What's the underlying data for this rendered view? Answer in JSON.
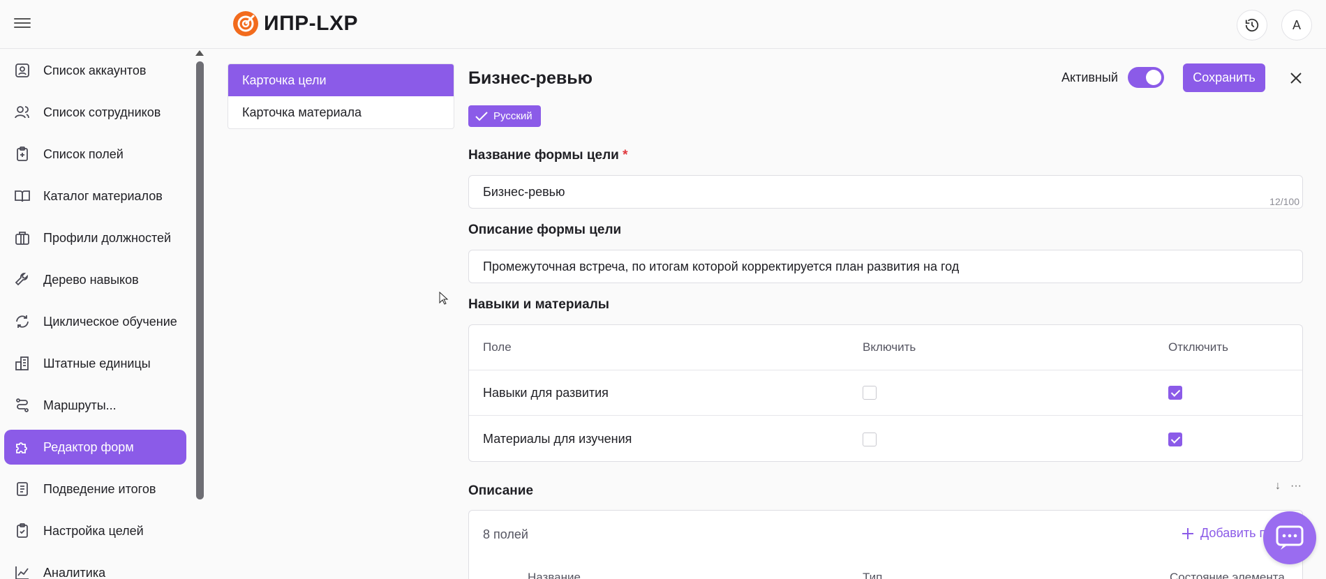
{
  "header": {
    "logo_text": "ИПР-LXP",
    "brand_color": "#f26b1d",
    "accent_color": "#8b5be8",
    "avatar_letter": "A"
  },
  "sidebar": {
    "items": [
      {
        "label": "Список аккаунтов",
        "icon": "account-card-icon"
      },
      {
        "label": "Список сотрудников",
        "icon": "users-icon"
      },
      {
        "label": "Список полей",
        "icon": "clipboard-plus-icon"
      },
      {
        "label": "Каталог материалов",
        "icon": "book-open-icon"
      },
      {
        "label": "Профили должностей",
        "icon": "briefcase-icon"
      },
      {
        "label": "Дерево навыков",
        "icon": "wrench-icon"
      },
      {
        "label": "Циклическое обучение",
        "icon": "refresh-icon"
      },
      {
        "label": "Штатные единицы",
        "icon": "building-icon"
      },
      {
        "label": "Маршруты...",
        "icon": "route-icon"
      },
      {
        "label": "Редактор форм",
        "icon": "puzzle-icon",
        "active": true
      },
      {
        "label": "Подведение итогов",
        "icon": "document-list-icon"
      },
      {
        "label": "Настройка целей",
        "icon": "clipboard-check-icon"
      },
      {
        "label": "Аналитика",
        "icon": "chart-line-icon"
      }
    ]
  },
  "cards": {
    "goal_card": "Карточка цели",
    "material_card": "Карточка материала"
  },
  "form": {
    "title": "Бизнес-ревью",
    "language": "Русский",
    "active_label": "Активный",
    "active": true,
    "save_label": "Сохранить",
    "name_label": "Название формы цели",
    "name_required_mark": "*",
    "name_value": "Бизнес-ревью",
    "name_counter": "12/100",
    "desc_label": "Описание формы цели",
    "desc_value": "Промежуточная встреча, по итогам которой корректируется план развития на год"
  },
  "skills": {
    "section_title": "Навыки и материалы",
    "columns": [
      "Поле",
      "Включить",
      "Отключить"
    ],
    "rows": [
      {
        "field": "Навыки для развития",
        "enable": false,
        "disable": true
      },
      {
        "field": "Материалы для изучения",
        "enable": false,
        "disable": true
      }
    ]
  },
  "description": {
    "section_title": "Описание",
    "fields_count": "8 полей",
    "add_label": "Добавить п",
    "columns": [
      "Название",
      "Тип",
      "Состояние элемента"
    ]
  }
}
